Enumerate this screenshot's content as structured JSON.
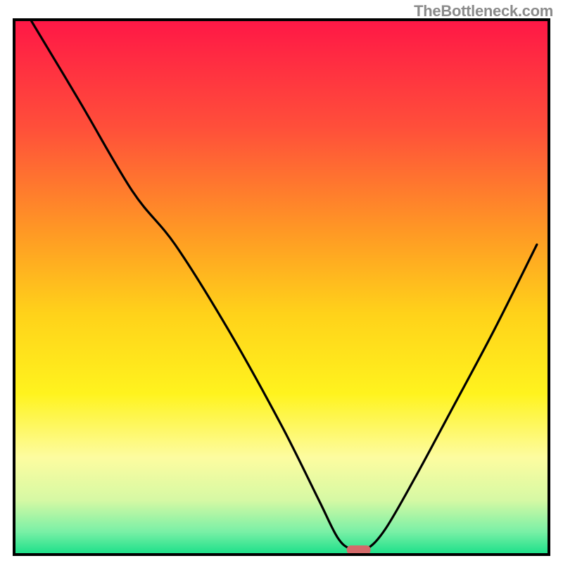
{
  "watermark": "TheBottleneck.com",
  "chart_data": {
    "type": "line",
    "title": "",
    "xlabel": "",
    "ylabel": "",
    "xlim": [
      0,
      100
    ],
    "ylim": [
      0,
      100
    ],
    "grid": false,
    "legend": false,
    "background": {
      "type": "vertical-gradient",
      "stops": [
        {
          "pos": 0.0,
          "color": "#ff1846"
        },
        {
          "pos": 0.2,
          "color": "#ff4f3a"
        },
        {
          "pos": 0.4,
          "color": "#ff9a24"
        },
        {
          "pos": 0.55,
          "color": "#ffd21a"
        },
        {
          "pos": 0.7,
          "color": "#fff31e"
        },
        {
          "pos": 0.82,
          "color": "#fdfca0"
        },
        {
          "pos": 0.9,
          "color": "#d6f9a4"
        },
        {
          "pos": 0.96,
          "color": "#79f0a6"
        },
        {
          "pos": 1.0,
          "color": "#1fe08a"
        }
      ]
    },
    "series": [
      {
        "name": "bottleneck-curve",
        "x": [
          3.0,
          12.0,
          22.0,
          30.0,
          40.0,
          50.0,
          57.0,
          60.5,
          63.0,
          66.0,
          69.5,
          75.0,
          82.0,
          90.0,
          98.0
        ],
        "values": [
          100.0,
          85.0,
          68.0,
          58.0,
          42.0,
          24.0,
          10.0,
          3.0,
          0.8,
          0.8,
          4.5,
          14.0,
          27.0,
          42.0,
          58.0
        ]
      }
    ],
    "marker": {
      "name": "optimal-point",
      "x": 64.5,
      "y": 0.0,
      "color": "#d46a6a",
      "shape": "rounded-capsule"
    }
  }
}
